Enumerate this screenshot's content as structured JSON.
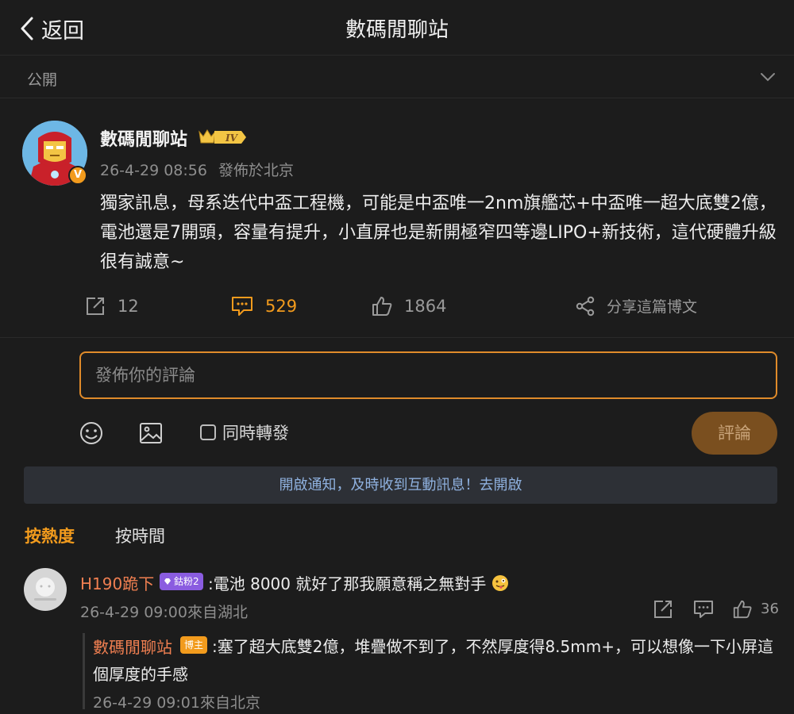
{
  "nav": {
    "back_label": "返回",
    "title": "數碼閒聊站"
  },
  "visibility": {
    "label": "公開"
  },
  "post": {
    "author": "數碼閒聊站",
    "level_badge": "IV",
    "avatar_badge": "V",
    "timestamp": "26-4-29 08:56",
    "source": "發佈於北京",
    "text": "獨家訊息，母系迭代中盃工程機，可能是中盃唯一2nm旗艦芯+中盃唯一超大底雙2億，電池還是7開頭，容量有提升，小直屏也是新開極窄四等邊LIPO+新技術，這代硬體升級很有誠意~"
  },
  "actions": {
    "repost_count": "12",
    "comment_count": "529",
    "like_count": "1864",
    "share_label": "分享這篇博文"
  },
  "composer": {
    "placeholder": "發佈你的評論",
    "repost_label": "同時轉發",
    "submit_label": "評論"
  },
  "notice": {
    "text": "開啟通知，及時收到互動訊息！去開啟"
  },
  "sort": {
    "hot": "按熱度",
    "time": "按時間"
  },
  "comments": [
    {
      "user": "H190跪下",
      "badge": "鈷粉2",
      "text": ":電池 8000 就好了那我願意稱之無對手",
      "timestamp": "26-4-29 09:00來自湖北",
      "likes": "36",
      "reply": {
        "user": "數碼閒聊站",
        "badge": "博主",
        "text": ":塞了超大底雙2億，堆疊做不到了，不然厚度得8.5mm+，可以想像一下小屏這個厚度的手感",
        "timestamp": "26-4-29 09:01來自北京"
      }
    }
  ],
  "colors": {
    "accent": "#f29b1d",
    "link": "#8fb1df",
    "username": "#f07f51",
    "background": "#1c1c1c"
  }
}
